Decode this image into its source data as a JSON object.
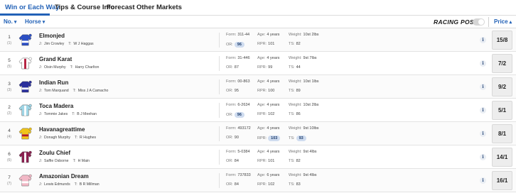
{
  "tabs": [
    "Win or Each Way",
    "Tips & Course Info",
    "Forecast",
    "Other Markets"
  ],
  "columns": {
    "no": "No.",
    "horse": "Horse",
    "price": "Price",
    "brand": "RACING POST"
  },
  "labels": {
    "form": "Form:",
    "age": "Age:",
    "weight": "Weight:",
    "or": "OR:",
    "rpr": "RPR:",
    "ts": "TS:",
    "jockey": "J:",
    "trainer": "T:"
  },
  "runners": [
    {
      "no": "1",
      "draw": "(1)",
      "name": "Elmonjed",
      "jockey": "Jim Crowley",
      "trainer": "W J Haggas",
      "form": "311-44",
      "age": "4 years",
      "weight": "10st 2lbs",
      "or": "96",
      "rpr": "101",
      "ts": "82",
      "price": "15/8",
      "silk_colors": [
        "#2c4fc4",
        "#ffffff"
      ]
    },
    {
      "no": "5",
      "draw": "(5)",
      "name": "Grand Karat",
      "jockey": "Oisin Murphy",
      "trainer": "Harry Charlton",
      "form": "31-446",
      "age": "4 years",
      "weight": "9st 7lbs",
      "or": "87",
      "rpr": "99",
      "ts": "44",
      "price": "7/2",
      "silk_colors": [
        "#ffffff",
        "#b31c3c"
      ]
    },
    {
      "no": "3",
      "draw": "(3)",
      "name": "Indian Run",
      "jockey": "Tom Marquand",
      "trainer": "Miss J A Camacho",
      "form": "00-863",
      "age": "4 years",
      "weight": "10st 1lbs",
      "or": "95",
      "rpr": "100",
      "ts": "89",
      "price": "9/2",
      "silk_colors": [
        "#2a2f9c",
        "#ffffff"
      ]
    },
    {
      "no": "2",
      "draw": "(2)",
      "name": "Toca Madera",
      "jockey": "Tommie Jakes",
      "trainer": "B J Meehan",
      "form": "6-2634",
      "age": "4 years",
      "weight": "10st 2lbs",
      "or": "96",
      "rpr": "102",
      "ts": "86",
      "price": "5/1",
      "silk_colors": [
        "#9fd6e6",
        "#ffffff"
      ]
    },
    {
      "no": "4",
      "draw": "(4)",
      "name": "Havanagreattime",
      "jockey": "Donagh Murphy",
      "trainer": "R Hughes",
      "form": "493172",
      "age": "4 years",
      "weight": "9st 10lbs",
      "or": "90",
      "rpr": "103",
      "ts": "93",
      "price": "8/1",
      "silk_colors": [
        "#f0c419",
        "#b3192e"
      ]
    },
    {
      "no": "6",
      "draw": "(6)",
      "name": "Zoulu Chief",
      "jockey": "Saffie Osborne",
      "trainer": "H Main",
      "form": "5-0384",
      "age": "4 years",
      "weight": "9st 4lbs",
      "or": "84",
      "rpr": "101",
      "ts": "82",
      "price": "14/1",
      "silk_colors": [
        "#8a1f4f",
        "#ffffff"
      ]
    },
    {
      "no": "7",
      "draw": "(7)",
      "name": "Amazonian Dream",
      "jockey": "Lewis Edmunds",
      "trainer": "B R Millman",
      "form": "737833",
      "age": "6 years",
      "weight": "9st 4lbs",
      "or": "84",
      "rpr": "102",
      "ts": "83",
      "price": "16/1",
      "silk_colors": [
        "#f2b8c6",
        "#ffffff"
      ]
    }
  ],
  "highlights": {
    "or_highlighted": [
      "96",
      "96"
    ],
    "rpr_highlighted": [
      "103"
    ],
    "ts_highlighted": [
      "93"
    ]
  },
  "colors": {
    "accent": "#2362b7",
    "bubble": "#cfdcef"
  }
}
